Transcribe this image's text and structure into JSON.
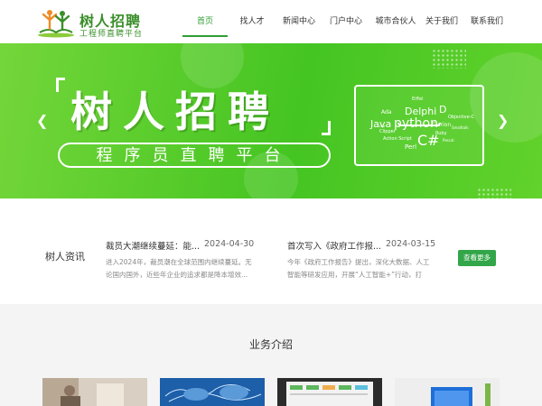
{
  "logo": {
    "title": "树人招聘",
    "subtitle": "工程师直聘平台"
  },
  "nav": {
    "items": [
      {
        "label": "首页",
        "active": true
      },
      {
        "label": "找人才",
        "active": false
      },
      {
        "label": "新闻中心",
        "active": false
      },
      {
        "label": "门户中心",
        "active": false
      },
      {
        "label": "城市合伙人",
        "active": false
      },
      {
        "label": "关于我们",
        "active": false
      },
      {
        "label": "联系我们",
        "active": false
      }
    ]
  },
  "banner": {
    "title": "树人招聘",
    "subtitle": "程序员直聘平台",
    "prev_icon": "chevron-left-icon",
    "next_icon": "chevron-right-icon",
    "word_cloud": [
      "Delphi",
      "Java",
      "python",
      "C#",
      "D",
      "Ada",
      "Eiffel",
      "Clarion",
      "Objective-C",
      "Perl",
      "Action Script",
      "Ruby",
      "Clipper",
      "Smalltalk",
      "Lisp",
      "Pascal"
    ]
  },
  "news": {
    "section_label": "树人资讯",
    "items": [
      {
        "title": "裁员大潮继续蔓延：能...",
        "date": "2024-04-30",
        "excerpt": "进入2024年，裁员潮在全球范围内继续蔓延。无论国内国外，近些年企业的追求都是降本增效..."
      },
      {
        "title": "首次写入《政府工作报...",
        "date": "2024-03-15",
        "excerpt": "今年《政府工作报告》提出，深化大数据、人工智能等研发应用，开展“人工智能+”行动，打造..."
      }
    ],
    "more_label": "查看更多"
  },
  "business": {
    "title": "业务介绍"
  },
  "colors": {
    "accent": "#2f9e33",
    "banner_green": "#45c522",
    "button_green": "#33a64a"
  }
}
